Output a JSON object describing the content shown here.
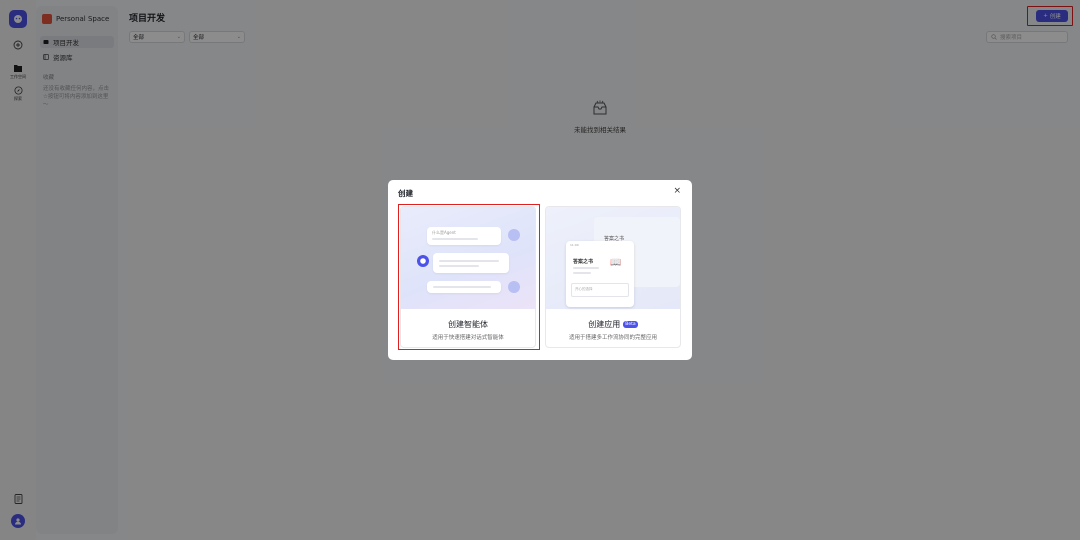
{
  "sidebar": {
    "space_name": "Personal Space",
    "rail": [
      {
        "label": "工作空间"
      },
      {
        "label": "探索"
      }
    ],
    "items": [
      {
        "label": "项目开发"
      },
      {
        "label": "资源库"
      }
    ],
    "favorites_title": "收藏",
    "favorites_empty": "还没有收藏任何内容，点击☆按钮可将内容添加到这里～"
  },
  "main": {
    "title": "项目开发",
    "filters": [
      {
        "value": "全部"
      },
      {
        "value": "全部"
      }
    ],
    "create_label": "创建",
    "search_placeholder": "搜索项目",
    "empty_text": "未能找到相关结果"
  },
  "modal": {
    "title": "创建",
    "cards": [
      {
        "title": "创建智能体",
        "desc": "适用于快速搭建对话式智能体",
        "preview_text": "什么是Agent"
      },
      {
        "title": "创建应用",
        "badge": "Beta",
        "desc": "适用于搭建多工作流协同的完整应用",
        "preview_title": "答案之书",
        "preview_phone_title": "答案之书",
        "preview_status": "11:00",
        "preview_input": "开心的选择"
      }
    ]
  },
  "colors": {
    "accent": "#4d53e8",
    "highlight": "#e02020"
  }
}
